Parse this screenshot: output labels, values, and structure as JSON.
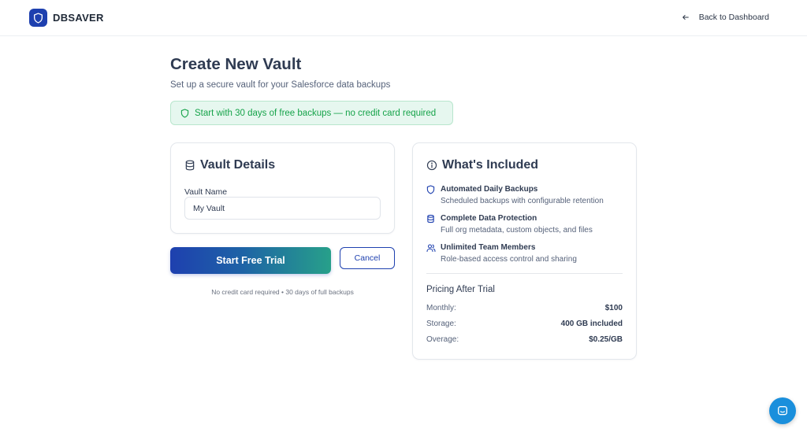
{
  "brand": {
    "name": "DBSAVER",
    "accent": "#1e40af"
  },
  "nav": {
    "back_label": "Back to Dashboard"
  },
  "page": {
    "title": "Create New Vault",
    "subtitle": "Set up a secure vault for your Salesforce data backups",
    "promo": "Start with 30 days of free backups — no credit card required"
  },
  "vault_details": {
    "title": "Vault Details",
    "name_label": "Vault Name",
    "name_value": "My Vault"
  },
  "actions": {
    "start_label": "Start Free Trial",
    "cancel_label": "Cancel",
    "footnote": "No credit card required • 30 days of full backups"
  },
  "included": {
    "title": "What's Included",
    "features": [
      {
        "icon": "shield-icon",
        "title": "Automated Daily Backups",
        "desc": "Scheduled backups with configurable retention"
      },
      {
        "icon": "database-icon",
        "title": "Complete Data Protection",
        "desc": "Full org metadata, custom objects, and files"
      },
      {
        "icon": "users-icon",
        "title": "Unlimited Team Members",
        "desc": "Role-based access control and sharing"
      }
    ],
    "pricing_title": "Pricing After Trial",
    "pricing": [
      {
        "label": "Monthly:",
        "value": "$100"
      },
      {
        "label": "Storage:",
        "value": "400 GB included"
      },
      {
        "label": "Overage:",
        "value": "$0.25/GB"
      }
    ]
  },
  "colors": {
    "promo_text": "#16a34a",
    "chat": "#1a8fdc"
  }
}
